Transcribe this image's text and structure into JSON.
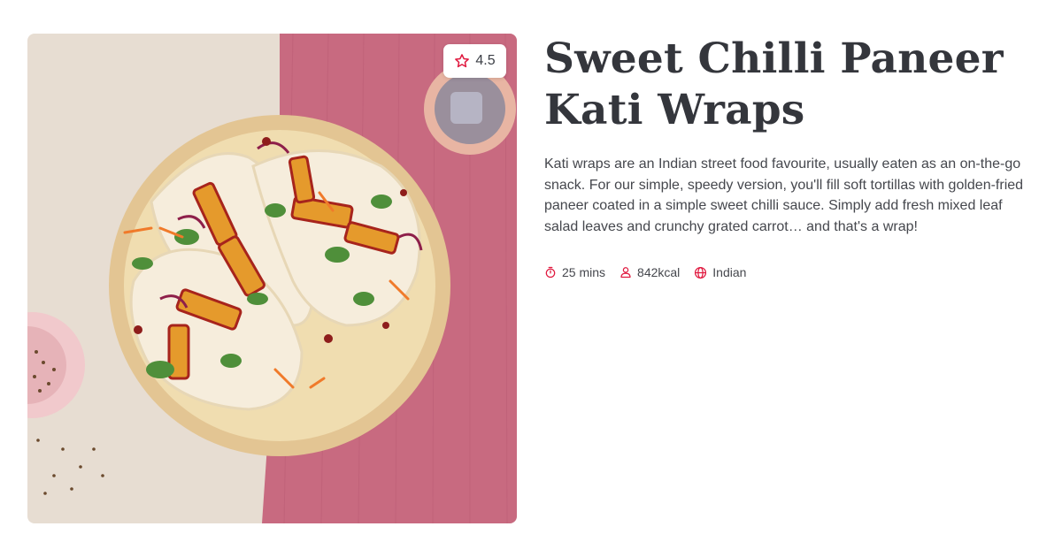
{
  "recipe": {
    "title": "Sweet Chilli Paneer Kati Wraps",
    "description": "Kati wraps are an Indian street food favourite, usually eaten as an on-the-go snack. For our simple, speedy version, you'll fill soft tortillas with golden-fried paneer coated in a simple sweet chilli sauce. Simply add fresh mixed leaf salad leaves and crunchy grated carrot… and that's a wrap!",
    "rating": "4.5",
    "meta": {
      "time": "25 mins",
      "calories": "842kcal",
      "cuisine": "Indian"
    }
  },
  "icons": {
    "rating": "star-icon",
    "time": "stopwatch-icon",
    "calories": "person-icon",
    "cuisine": "globe-icon"
  },
  "colors": {
    "accent": "#e0193f",
    "title": "#34363c",
    "body_text": "#45474d"
  }
}
